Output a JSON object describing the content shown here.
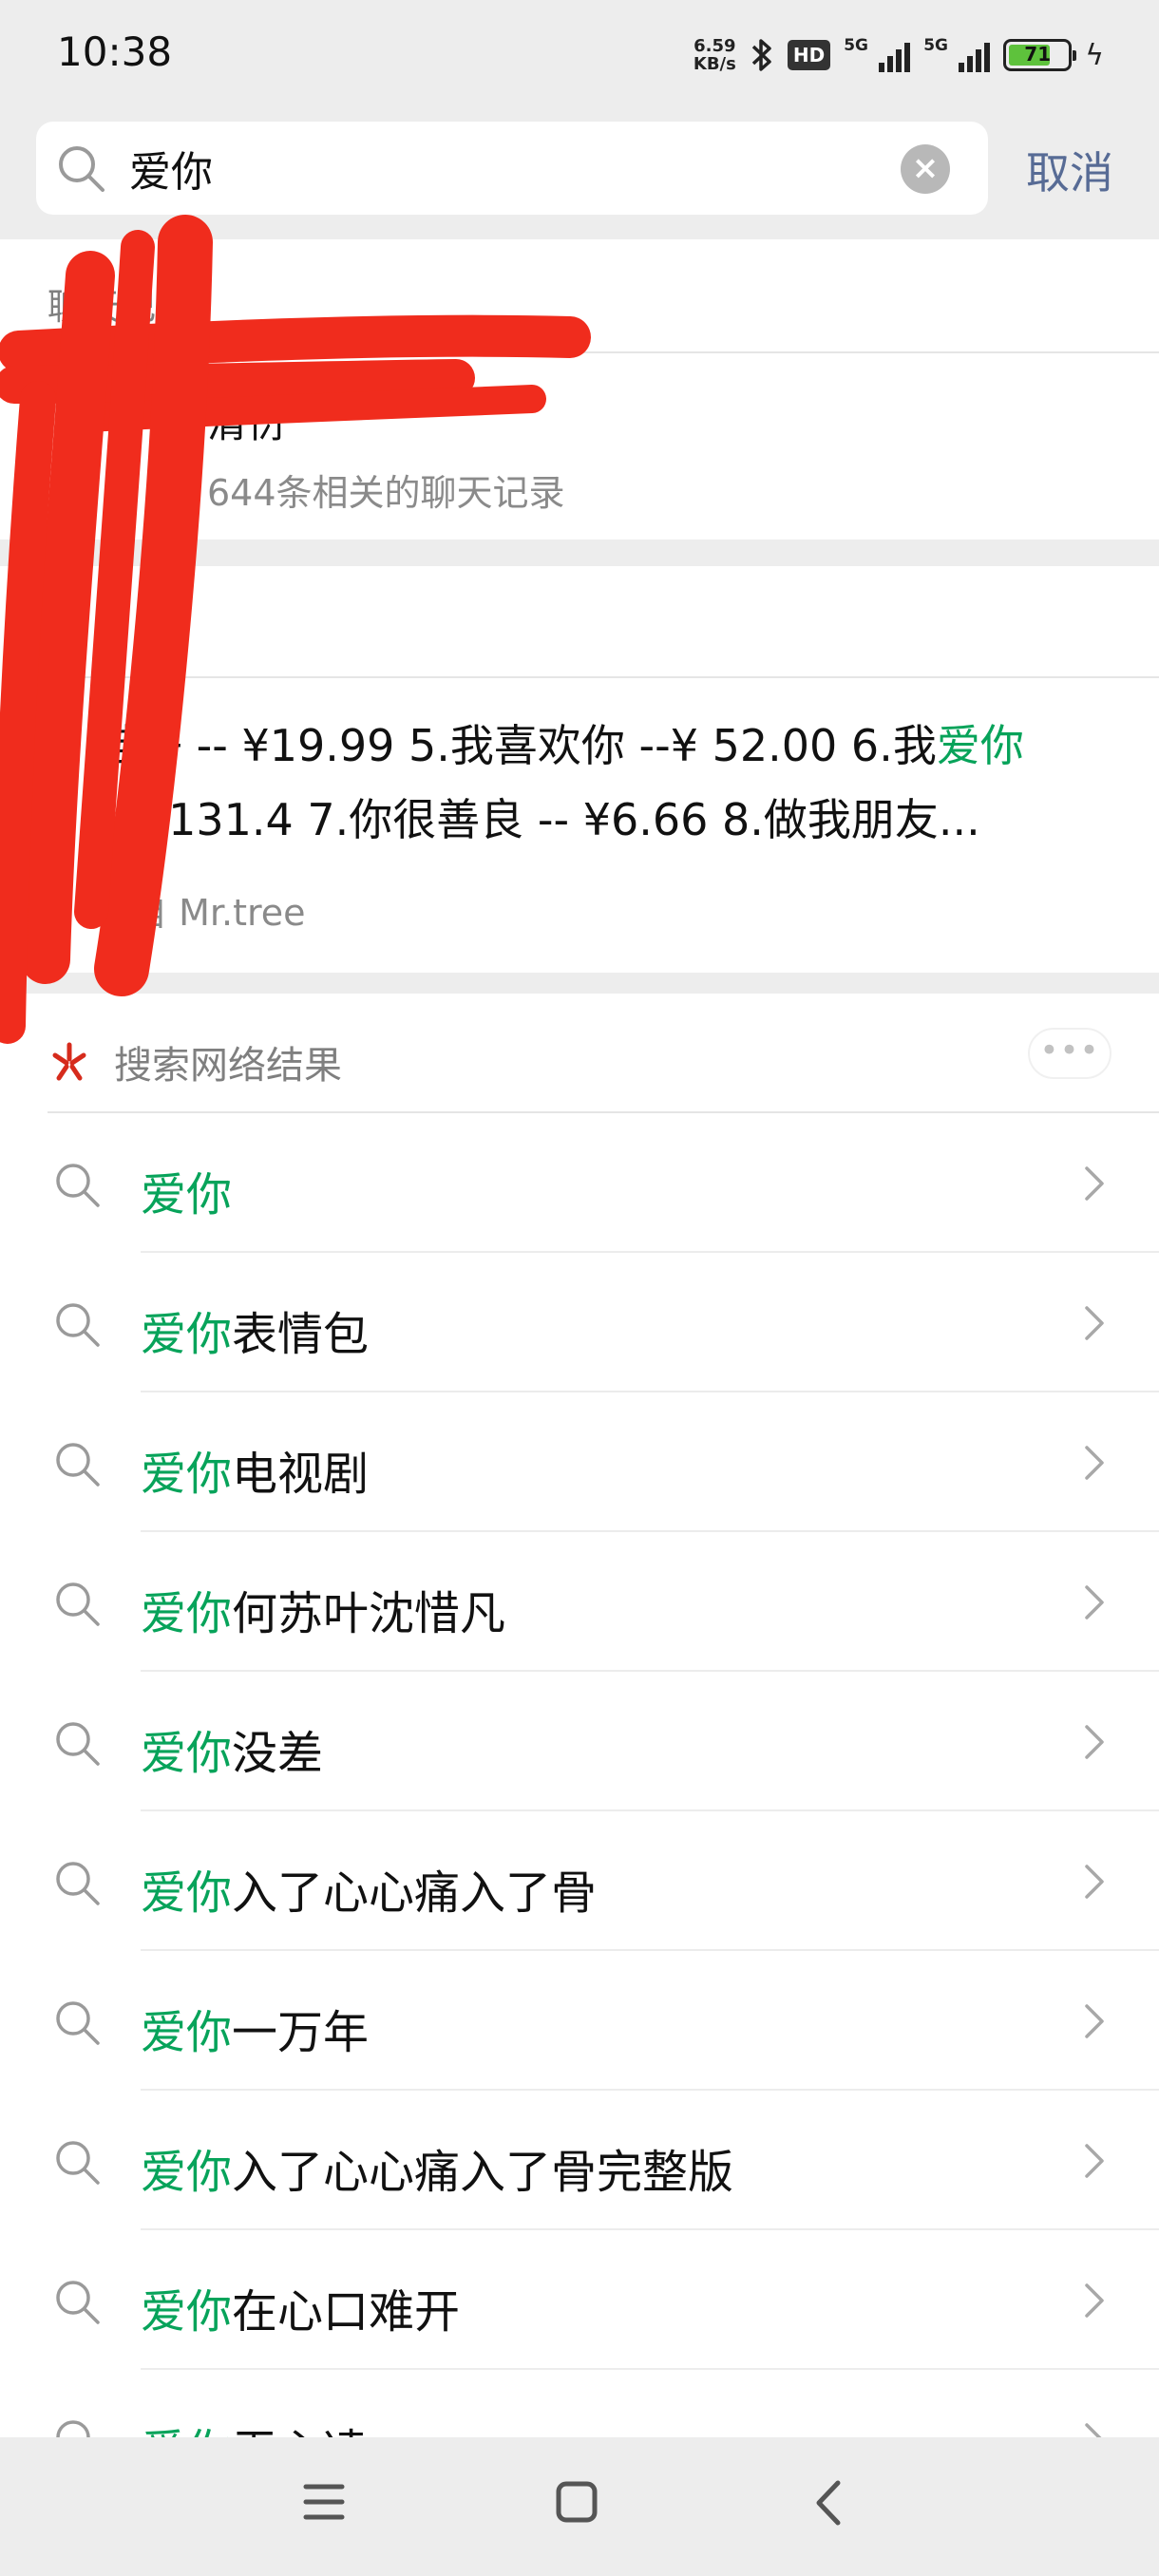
{
  "status_bar": {
    "time": "10:38",
    "net_speed_value": "6.59",
    "net_speed_unit": "KB/s",
    "hd_label": "HD",
    "signal1_label": "5G",
    "signal2_label": "5G",
    "battery_level": "71",
    "battery_percent": 71,
    "icons": [
      "bluetooth-icon",
      "signal-icon",
      "signal-icon",
      "battery-icon",
      "charging-icon"
    ]
  },
  "search": {
    "query": "爱你",
    "cancel_label": "取消"
  },
  "chat_records": {
    "header": "聊天记录",
    "contact_name": "清衍",
    "count_text": "644条相关的聊天记录"
  },
  "article": {
    "line1_prefix": "鞋子 -- ¥19.99 5.我喜欢你 --¥ 52.00 6.我",
    "line1_highlight": "爱你",
    "line2": "-- ¥131.4 7.你很善良 -- ¥6.66 8.做我朋友...",
    "source": "来自 Mr.tree"
  },
  "web_results": {
    "header": "搜索网络结果",
    "more_label": "•••",
    "suggestions": [
      {
        "keyword": "爱你",
        "rest": ""
      },
      {
        "keyword": "爱你",
        "rest": "表情包"
      },
      {
        "keyword": "爱你",
        "rest": "电视剧"
      },
      {
        "keyword": "爱你",
        "rest": "何苏叶沈惜凡"
      },
      {
        "keyword": "爱你",
        "rest": "没差"
      },
      {
        "keyword": "爱你",
        "rest": "入了心心痛入了骨"
      },
      {
        "keyword": "爱你",
        "rest": "一万年"
      },
      {
        "keyword": "爱你",
        "rest": "入了心心痛入了骨完整版"
      },
      {
        "keyword": "爱你",
        "rest": "在心口难开"
      },
      {
        "keyword": "爱你",
        "rest": "无心凌"
      }
    ]
  },
  "colors": {
    "accent_green": "#07a35a",
    "link_blue": "#576b95",
    "redaction_red": "#f02c1d",
    "background": "#ededed"
  }
}
